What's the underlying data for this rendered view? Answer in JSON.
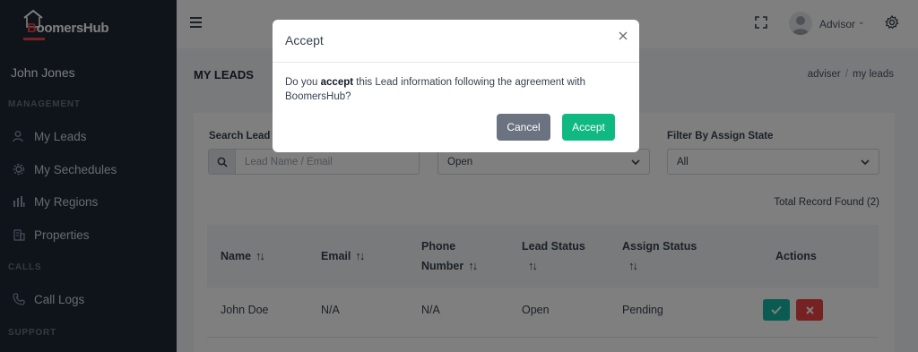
{
  "brand": {
    "logo_text_b": "B",
    "logo_text_rest": "oomersHub"
  },
  "sidebar": {
    "user_name": "John Jones",
    "sections": {
      "management": "MANAGEMENT",
      "calls": "CALLS",
      "support": "SUPPORT"
    },
    "items": [
      {
        "label": "My Leads",
        "icon": "user-icon"
      },
      {
        "label": "My Sechedules",
        "icon": "gear-schedule-icon"
      },
      {
        "label": "My Regions",
        "icon": "chart-icon"
      },
      {
        "label": "Properties",
        "icon": "building-icon"
      },
      {
        "label": "Call Logs",
        "icon": "phone-icon"
      }
    ]
  },
  "header": {
    "user_label": "Advisor"
  },
  "page": {
    "title": "MY LEADS",
    "breadcrumb": [
      "adviser",
      "my leads"
    ]
  },
  "filters": {
    "search_label": "Search Lead",
    "search_placeholder": "Lead Name / Email",
    "lead_status_value": "Open",
    "assign_label": "Filter By Assign State",
    "assign_value": "All"
  },
  "table": {
    "total_text": "Total Record Found (2)",
    "columns": [
      "Name",
      "Email",
      "Phone",
      "Number",
      "Lead Status",
      "Assign Status",
      "Actions"
    ],
    "sort_glyph": "↑↓",
    "rows": [
      {
        "name": "John Doe",
        "email": "N/A",
        "phone": "N/A",
        "lead_status": "Open",
        "assign_status": "Pending"
      }
    ]
  },
  "modal": {
    "title": "Accept",
    "body_pre": "Do you ",
    "body_bold": "accept",
    "body_post": " this Lead information following the agreement with BoomersHub?",
    "cancel_label": "Cancel",
    "accept_label": "Accept"
  },
  "colors": {
    "sidebar": "#1f2937",
    "accept": "#10b981",
    "cancel": "#6b7280",
    "danger": "#ef4444",
    "teal": "#14b8a6"
  }
}
